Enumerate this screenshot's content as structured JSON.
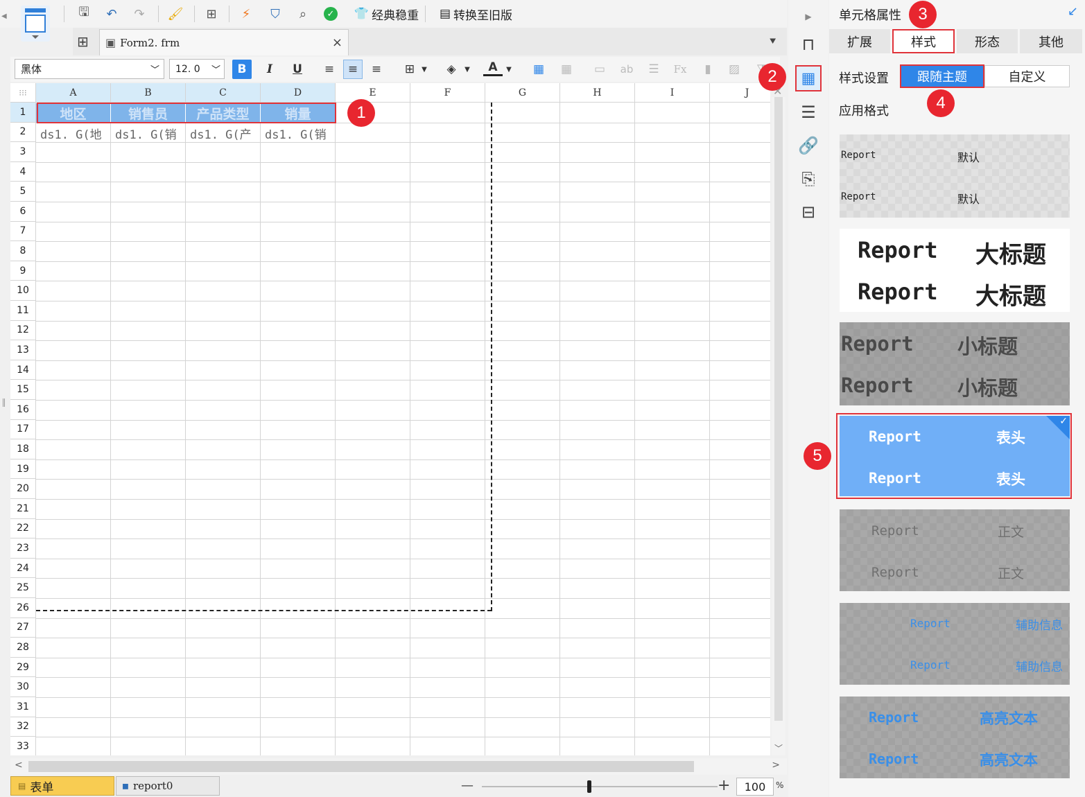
{
  "toolbar": {
    "theme_label": "经典稳重",
    "convert_label": "转换至旧版"
  },
  "file_tab": {
    "name": "Form2. frm"
  },
  "format": {
    "font": "黑体",
    "size": "12. 0"
  },
  "grid": {
    "columns": [
      "A",
      "B",
      "C",
      "D",
      "E",
      "F",
      "G",
      "H",
      "I",
      "J"
    ],
    "rows": [
      "1",
      "2",
      "3",
      "4",
      "5",
      "6",
      "7",
      "8",
      "9",
      "10",
      "11",
      "12",
      "13",
      "14",
      "15",
      "16",
      "17",
      "18",
      "19",
      "20",
      "21",
      "22",
      "23",
      "24",
      "25",
      "26",
      "27",
      "28",
      "29",
      "30",
      "31",
      "32",
      "33"
    ],
    "header_row": [
      "地区",
      "销售员",
      "产品类型",
      "销量"
    ],
    "data_row": [
      "ds1. G(地",
      "ds1. G(销",
      "ds1. G(产",
      "ds1. G(销"
    ]
  },
  "sheets": [
    {
      "label": "表单"
    },
    {
      "label": "report0"
    }
  ],
  "zoom": {
    "value": "100",
    "unit": "%",
    "minus": "—",
    "plus": "+"
  },
  "panel": {
    "title": "单元格属性",
    "tabs": [
      "扩展",
      "样式",
      "形态",
      "其他"
    ],
    "style_setting_label": "样式设置",
    "follow_theme": "跟随主题",
    "custom": "自定义",
    "apply_format_label": "应用格式",
    "styles": [
      {
        "left": "Report",
        "right": "默认"
      },
      {
        "left": "Report",
        "right": "大标题"
      },
      {
        "left": "Report",
        "right": "小标题"
      },
      {
        "left": "Report",
        "right": "表头"
      },
      {
        "left": "Report",
        "right": "正文"
      },
      {
        "left": "Report",
        "right": "辅助信息"
      },
      {
        "left": "Report",
        "right": "高亮文本"
      }
    ]
  },
  "badges": [
    "1",
    "2",
    "3",
    "4",
    "5"
  ],
  "colors": {
    "header_fill": "#7fb4ea",
    "selected_style": "#70aff7",
    "accent": "#2f86e8",
    "badge": "#e8262f"
  }
}
